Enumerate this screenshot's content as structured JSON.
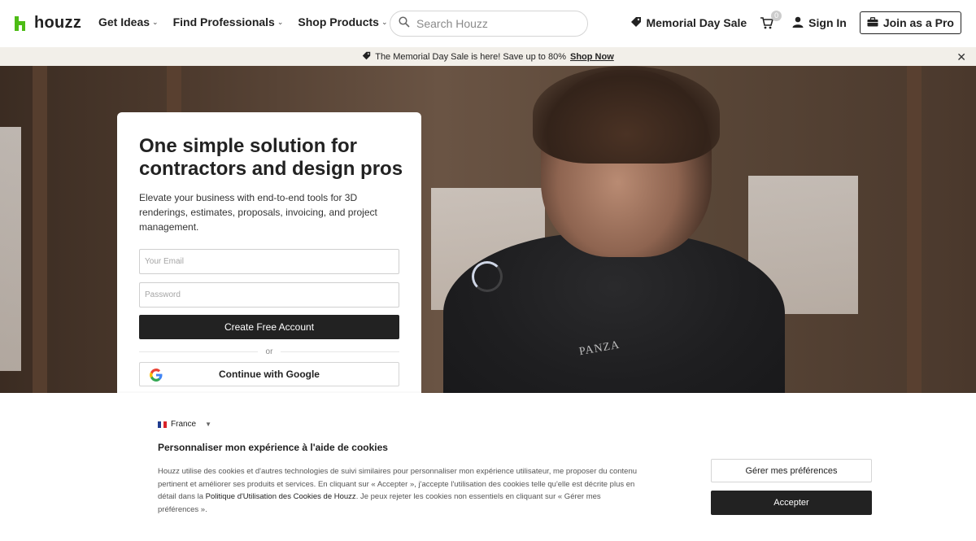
{
  "nav": {
    "logo_text": "houzz",
    "menu": [
      {
        "label": "Get Ideas"
      },
      {
        "label": "Find Professionals"
      },
      {
        "label": "Shop Products"
      }
    ],
    "search_placeholder": "Search Houzz",
    "sale_label": "Memorial Day Sale",
    "cart_count": "0",
    "signin_label": "Sign In",
    "join_label": "Join as a Pro"
  },
  "promo": {
    "text": "The Memorial Day Sale is here! Save up to 80%",
    "link": "Shop Now",
    "close": "✕"
  },
  "hero": {
    "shirt_text": "PANZA"
  },
  "signup": {
    "title": "One simple solution for contractors and design pros",
    "description": "Elevate your business with end-to-end tools for 3D renderings, estimates, proposals, invoicing, and project management.",
    "email_placeholder": "Your Email",
    "password_placeholder": "Password",
    "create_label": "Create Free Account",
    "or_label": "or",
    "google_label": "Continue with Google"
  },
  "cookie": {
    "country": "France",
    "title": "Personnaliser mon expérience à l'aide de cookies",
    "text_before": "Houzz utilise des cookies et d'autres technologies de suivi similaires pour personnaliser mon expérience utilisateur, me proposer du contenu pertinent et améliorer ses produits et services. En cliquant sur « Accepter », j'accepte l'utilisation des cookies telle qu'elle est décrite plus en détail dans la ",
    "policy_link": "Politique d'Utilisation des Cookies de Houzz",
    "text_after": ". Je peux rejeter les cookies non essentiels en cliquant sur « Gérer mes préférences ».",
    "prefs_label": "Gérer mes préférences",
    "accept_label": "Accepter"
  },
  "colors": {
    "brand_green": "#4dbc15",
    "dark": "#222222",
    "promo_bg": "#f2efe9"
  }
}
